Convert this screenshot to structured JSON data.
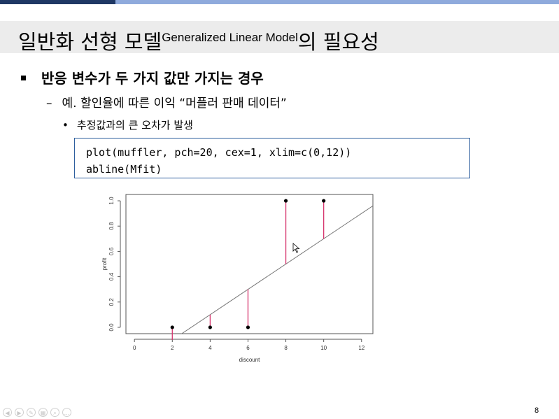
{
  "slide": {
    "title_main": "일반화 선형 모델",
    "title_sup": "Generalized Linear Model",
    "title_suffix": "의 필요성",
    "bullet1": "반응 변수가 두 가지 값만 가지는 경우",
    "bullet2_marker": "–",
    "bullet2": "예.  할인율에 따른 이익 “머플러 판매 데이터”",
    "bullet3_marker": "•",
    "bullet3": "추정값과의 큰 오차가 발생",
    "code_lines": [
      "plot(muffler, pch=20, cex=1, xlim=c(0,12))",
      "abline(Mfit)"
    ],
    "page_number": "8"
  },
  "nav": {
    "buttons": [
      {
        "name": "previous-slide",
        "glyph": "◀"
      },
      {
        "name": "next-slide",
        "glyph": "▶"
      },
      {
        "name": "pen-tool",
        "glyph": "✎"
      },
      {
        "name": "slides-view",
        "glyph": "▦"
      },
      {
        "name": "zoom",
        "glyph": "⌕"
      },
      {
        "name": "more-options",
        "glyph": "…"
      }
    ]
  },
  "colors": {
    "top_bar_dark": "#1f3864",
    "top_bar_light": "#8faadc",
    "title_band": "#ececec",
    "code_border": "#2e5f9e",
    "residual_line": "#d6336c",
    "fit_line": "#777777"
  },
  "chart_data": {
    "type": "scatter",
    "xlabel": "discount",
    "ylabel": "profit",
    "xlim": [
      0,
      12
    ],
    "ylim": [
      0,
      1
    ],
    "xticks": [
      0,
      2,
      4,
      6,
      8,
      10,
      12
    ],
    "yticks": [
      0.0,
      0.2,
      0.4,
      0.6,
      0.8,
      1.0
    ],
    "yticklabels": [
      "0.0",
      "0.2",
      "0.4",
      "0.6",
      "0.8",
      "1.0"
    ],
    "points": [
      {
        "x": 2,
        "y": 0
      },
      {
        "x": 4,
        "y": 0
      },
      {
        "x": 6,
        "y": 0
      },
      {
        "x": 8,
        "y": 1
      },
      {
        "x": 10,
        "y": 1
      }
    ],
    "fit_line": {
      "intercept": -0.3,
      "slope": 0.1
    },
    "residuals": true,
    "grid": false
  }
}
